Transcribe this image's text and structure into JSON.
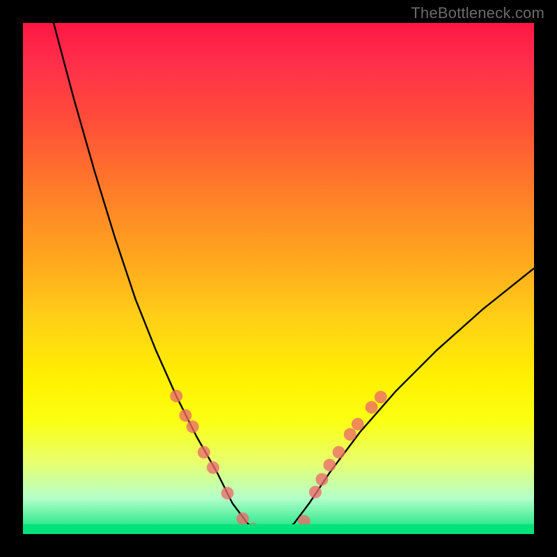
{
  "watermark": "TheBottleneck.com",
  "chart_data": {
    "type": "line",
    "title": "",
    "xlabel": "",
    "ylabel": "",
    "series": [
      {
        "name": "curve",
        "x": [
          0.06,
          0.1,
          0.14,
          0.18,
          0.22,
          0.26,
          0.3,
          0.34,
          0.38,
          0.41,
          0.44,
          0.47,
          0.5,
          0.53,
          0.56,
          0.6,
          0.66,
          0.73,
          0.81,
          0.9,
          1.0
        ],
        "y": [
          1.0,
          0.85,
          0.71,
          0.58,
          0.46,
          0.36,
          0.27,
          0.19,
          0.12,
          0.06,
          0.02,
          0.0,
          0.0,
          0.02,
          0.06,
          0.12,
          0.2,
          0.28,
          0.36,
          0.44,
          0.52
        ]
      }
    ],
    "markers": {
      "left_branch": [
        {
          "x": 0.3,
          "y": 0.27
        },
        {
          "x": 0.318,
          "y": 0.232
        },
        {
          "x": 0.332,
          "y": 0.21
        },
        {
          "x": 0.354,
          "y": 0.16
        },
        {
          "x": 0.372,
          "y": 0.13
        },
        {
          "x": 0.4,
          "y": 0.08
        },
        {
          "x": 0.43,
          "y": 0.03
        }
      ],
      "bottom": [
        {
          "x": 0.45,
          "y": 0.01
        },
        {
          "x": 0.475,
          "y": 0.002
        },
        {
          "x": 0.5,
          "y": 0.0
        },
        {
          "x": 0.525,
          "y": 0.006
        },
        {
          "x": 0.55,
          "y": 0.025
        }
      ],
      "right_branch": [
        {
          "x": 0.572,
          "y": 0.082
        },
        {
          "x": 0.585,
          "y": 0.107
        },
        {
          "x": 0.6,
          "y": 0.135
        },
        {
          "x": 0.618,
          "y": 0.16
        },
        {
          "x": 0.64,
          "y": 0.195
        },
        {
          "x": 0.655,
          "y": 0.215
        },
        {
          "x": 0.682,
          "y": 0.248
        },
        {
          "x": 0.7,
          "y": 0.268
        }
      ]
    },
    "xlim": [
      0,
      1
    ],
    "ylim": [
      0,
      1
    ],
    "colors": {
      "curve": "#000000",
      "marker": "#ec6a6a",
      "gradient_top": "#ff1744",
      "gradient_bottom": "#04e27b"
    }
  }
}
